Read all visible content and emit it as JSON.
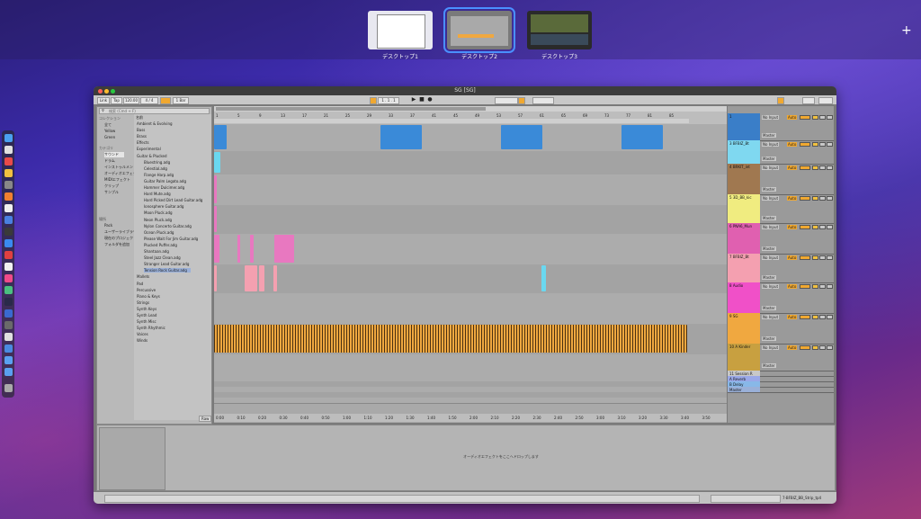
{
  "desktops": [
    {
      "label": "デスクトップ1"
    },
    {
      "label": "デスクトップ2"
    },
    {
      "label": "デスクトップ3"
    }
  ],
  "add_label": "+",
  "window": {
    "title": "SG [SG]"
  },
  "toolbar": {
    "link": "Link",
    "tap": "Tap",
    "tempo": "120.00",
    "signature": "4 / 4",
    "bar": "1 Bar",
    "position": "1 . 1 . 1"
  },
  "browser": {
    "search_placeholder": "検索 (Cmd + F)",
    "collections_label": "コレクション",
    "collections": [
      "全て",
      "Yellow",
      "Green"
    ],
    "categories_label": "カテゴリ",
    "categories": [
      "サウンド",
      "ドラム",
      "インストゥルメント",
      "オーディオエフェクト",
      "MIDIエフェクト",
      "クリップ",
      "サンプル"
    ],
    "places_label": "場所",
    "places": [
      "Pack",
      "ユーザーライブラリ",
      "現在のプロジェクト",
      "フォルダを追加"
    ],
    "name_label": "名前",
    "items": [
      "Ambient & Evolving",
      "Bass",
      "Brass",
      "Effects",
      "Experimental",
      "Guitar & Plucked",
      "Bluestring.adg",
      "Celestial.adg",
      "Flange Harp.adg",
      "Guitar Palm Legato.adg",
      "Hammer Dulcimer.adg",
      "Hard Mute.adg",
      "Hard Picked Dirt Lead Guitar.adg",
      "Ionosphere Guitar.adg",
      "Moon Pluck.adg",
      "Neon Pluck.adg",
      "Nylon Concerto Guitar.adg",
      "Ocean Pluck.adg",
      "Please Wait For Jim Guitar.adg",
      "Plucked Puffer.adg",
      "Shantaan.adg",
      "Steel Jazz Clean.adg",
      "Stranger Lead Guitar.adg",
      "Tension Rock Guitar.adg",
      "Mallets",
      "Pad",
      "Percussive",
      "Piano & Keys",
      "Strings",
      "Synth Keys",
      "Synth Lead",
      "Synth Misc",
      "Synth Rhythmic",
      "Voices",
      "Winds"
    ],
    "preview": "Raw"
  },
  "ruler_ticks": [
    "1",
    "5",
    "9",
    "13",
    "17",
    "21",
    "25",
    "29",
    "33",
    "37",
    "41",
    "45",
    "49",
    "53",
    "57",
    "61",
    "65",
    "69",
    "73",
    "77",
    "81",
    "85"
  ],
  "time_ticks": [
    "0:00",
    "0:10",
    "0:20",
    "0:30",
    "0:40",
    "0:50",
    "1:00",
    "1:10",
    "1:20",
    "1:30",
    "1:40",
    "1:50",
    "2:00",
    "2:10",
    "2:20",
    "2:30",
    "2:40",
    "2:50",
    "3:00",
    "3:10",
    "3:20",
    "3:30",
    "3:40",
    "3:50"
  ],
  "tracks": [
    {
      "name": "1 ",
      "color": "#3a7ec8"
    },
    {
      "name": "3 BFBIZ_Bt",
      "color": "#7fd8f0"
    },
    {
      "name": "4 BRKIT_int",
      "color": "#a07850"
    },
    {
      "name": "5 3D_BB_kic",
      "color": "#f0ec80"
    },
    {
      "name": "6 PNA6_Mun",
      "color": "#e060b0"
    },
    {
      "name": "7 BFBIZ_Bt",
      "color": "#f4a0b0"
    },
    {
      "name": "8 Audio",
      "color": "#f050c8"
    },
    {
      "name": "9 SG",
      "color": "#f0a840"
    },
    {
      "name": "10 A Kinder",
      "color": "#c8a040"
    },
    {
      "name": "11 Session R",
      "color": "#c8c8c8"
    },
    {
      "name": "A Reverb",
      "color": "#9aa8e8"
    },
    {
      "name": "B Delay",
      "color": "#88b8e8"
    },
    {
      "name": "Master",
      "color": "#9ab0d8"
    }
  ],
  "mixer_input": "No Input",
  "mixer_auto": "Auto",
  "mixer_master": "Master",
  "detail_hint": "オーディオエフェクトをここへドロップします",
  "status_right": "7-BFBIZ_BB_Strip_tp4",
  "colors": {
    "clip_blue": "#3a8ad8",
    "clip_cyan": "#6ad8f0",
    "clip_pink": "#e878c0",
    "clip_orange": "#f0a840",
    "clip_salmon": "#f4a0b0"
  }
}
